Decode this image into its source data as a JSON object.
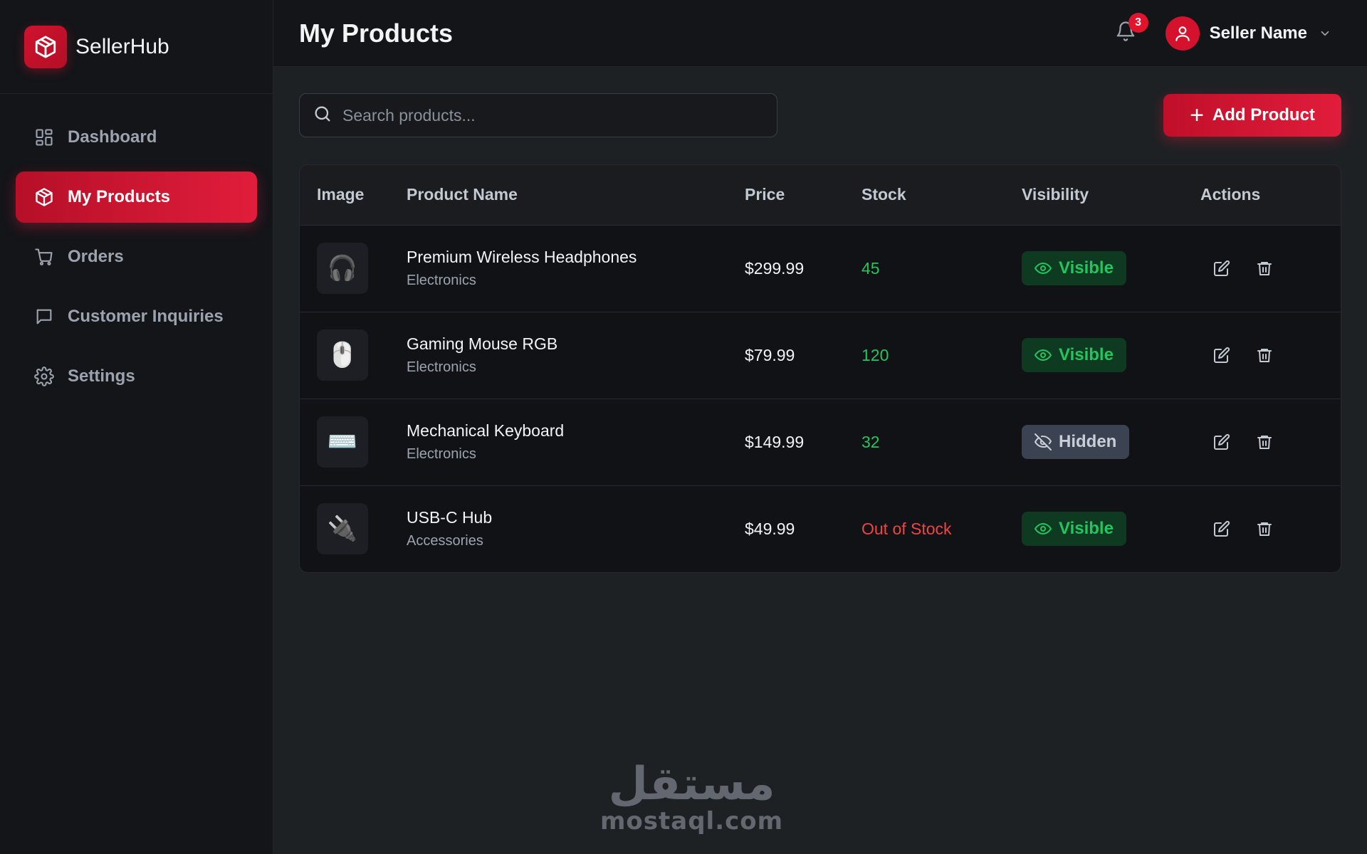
{
  "brand": {
    "name": "SellerHub",
    "logo_icon": "box-icon",
    "accent": "#e11d3b"
  },
  "sidebar": {
    "items": [
      {
        "label": "Dashboard",
        "icon": "dashboard-grid-icon",
        "active": false
      },
      {
        "label": "My Products",
        "icon": "box-icon",
        "active": true
      },
      {
        "label": "Orders",
        "icon": "cart-icon",
        "active": false
      },
      {
        "label": "Customer Inquiries",
        "icon": "chat-icon",
        "active": false
      },
      {
        "label": "Settings",
        "icon": "gear-icon",
        "active": false
      }
    ]
  },
  "header": {
    "title": "My Products",
    "notifications_count": "3",
    "user_name": "Seller Name"
  },
  "toolbar": {
    "search_placeholder": "Search products...",
    "add_label": "Add Product"
  },
  "table": {
    "columns": [
      "Image",
      "Product Name",
      "Price",
      "Stock",
      "Visibility",
      "Actions"
    ],
    "rows": [
      {
        "image": "🎧",
        "name": "Premium Wireless Headphones",
        "category": "Electronics",
        "price": "$299.99",
        "stock": "45",
        "stock_status": "in",
        "visibility": "Visible"
      },
      {
        "image": "🖱️",
        "name": "Gaming Mouse RGB",
        "category": "Electronics",
        "price": "$79.99",
        "stock": "120",
        "stock_status": "in",
        "visibility": "Visible"
      },
      {
        "image": "⌨️",
        "name": "Mechanical Keyboard",
        "category": "Electronics",
        "price": "$149.99",
        "stock": "32",
        "stock_status": "in",
        "visibility": "Hidden"
      },
      {
        "image": "🔌",
        "name": "USB-C Hub",
        "category": "Accessories",
        "price": "$49.99",
        "stock": "Out of Stock",
        "stock_status": "out",
        "visibility": "Visible"
      }
    ]
  },
  "colors": {
    "in_stock": "#22c55e",
    "out_of_stock": "#ef4444",
    "visible_bg": "#0f3a22",
    "hidden_bg": "#3b4251"
  },
  "watermark": {
    "arabic": "مستقل",
    "latin": "mostaql.com"
  }
}
